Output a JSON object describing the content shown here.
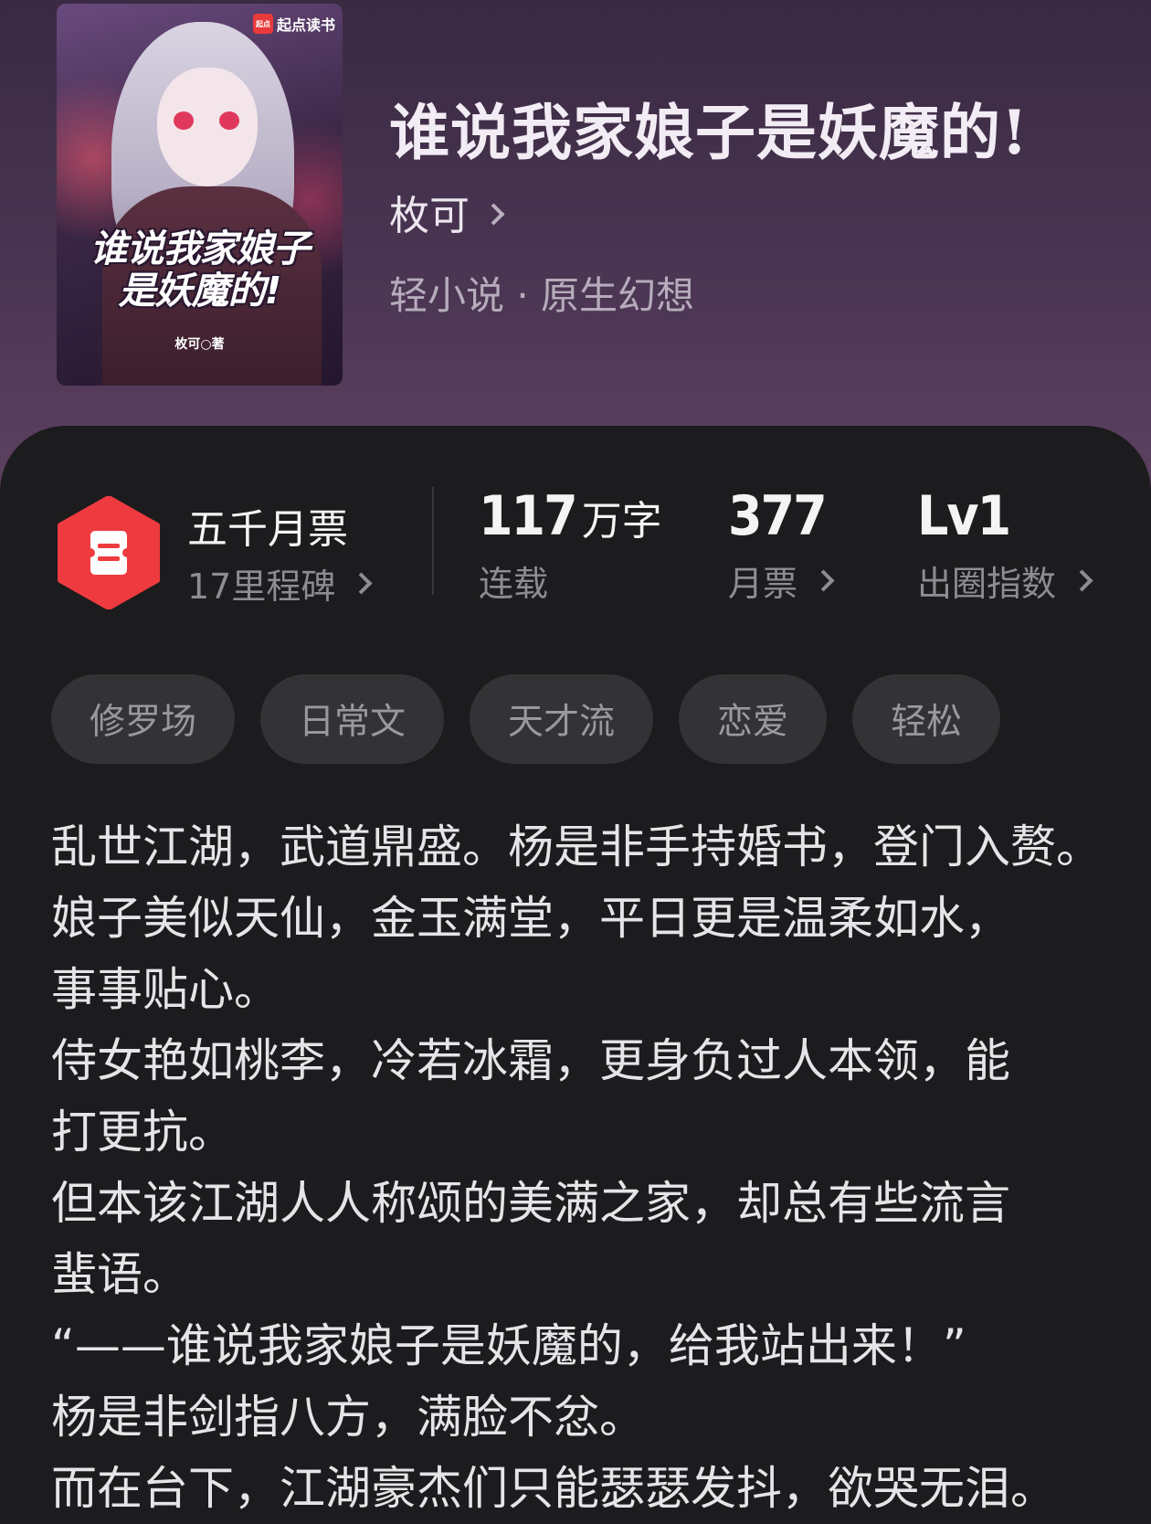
{
  "book": {
    "cover": {
      "publisher": "起点读书",
      "publisher_logo": "起点",
      "title_line1": "谁说我家娘子",
      "title_line2": "是妖魔的!",
      "author": "枚可○著"
    },
    "title": "谁说我家娘子是妖魔的!",
    "author": "枚可",
    "genre": "轻小说 · 原生幻想"
  },
  "stats": {
    "badge_icon": "ticket-icon",
    "badge_color": "#ee3b3f",
    "milestone_title": "五千月票",
    "milestone_sub": "17里程碑",
    "word_count": "117",
    "word_unit": "万字",
    "status": "连载",
    "monthly_votes": "377",
    "monthly_votes_label": "月票",
    "level": "Lv1",
    "level_label": "出圈指数"
  },
  "tags": [
    "修罗场",
    "日常文",
    "天才流",
    "恋爱",
    "轻松"
  ],
  "synopsis": [
    "乱世江湖，武道鼎盛。杨是非手持婚书，登门入赘。",
    "娘子美似天仙，金玉满堂，平日更是温柔如水，",
    "事事贴心。",
    "侍女艳如桃李，冷若冰霜，更身负过人本领，能",
    "打更抗。",
    "但本该江湖人人称颂的美满之家，却总有些流言",
    "蜚语。",
    "“——谁说我家娘子是妖魔的，给我站出来！”",
    "杨是非剑指八方，满脸不忿。",
    "而在台下，江湖豪杰们只能瑟瑟发抖，欲哭无泪。"
  ]
}
